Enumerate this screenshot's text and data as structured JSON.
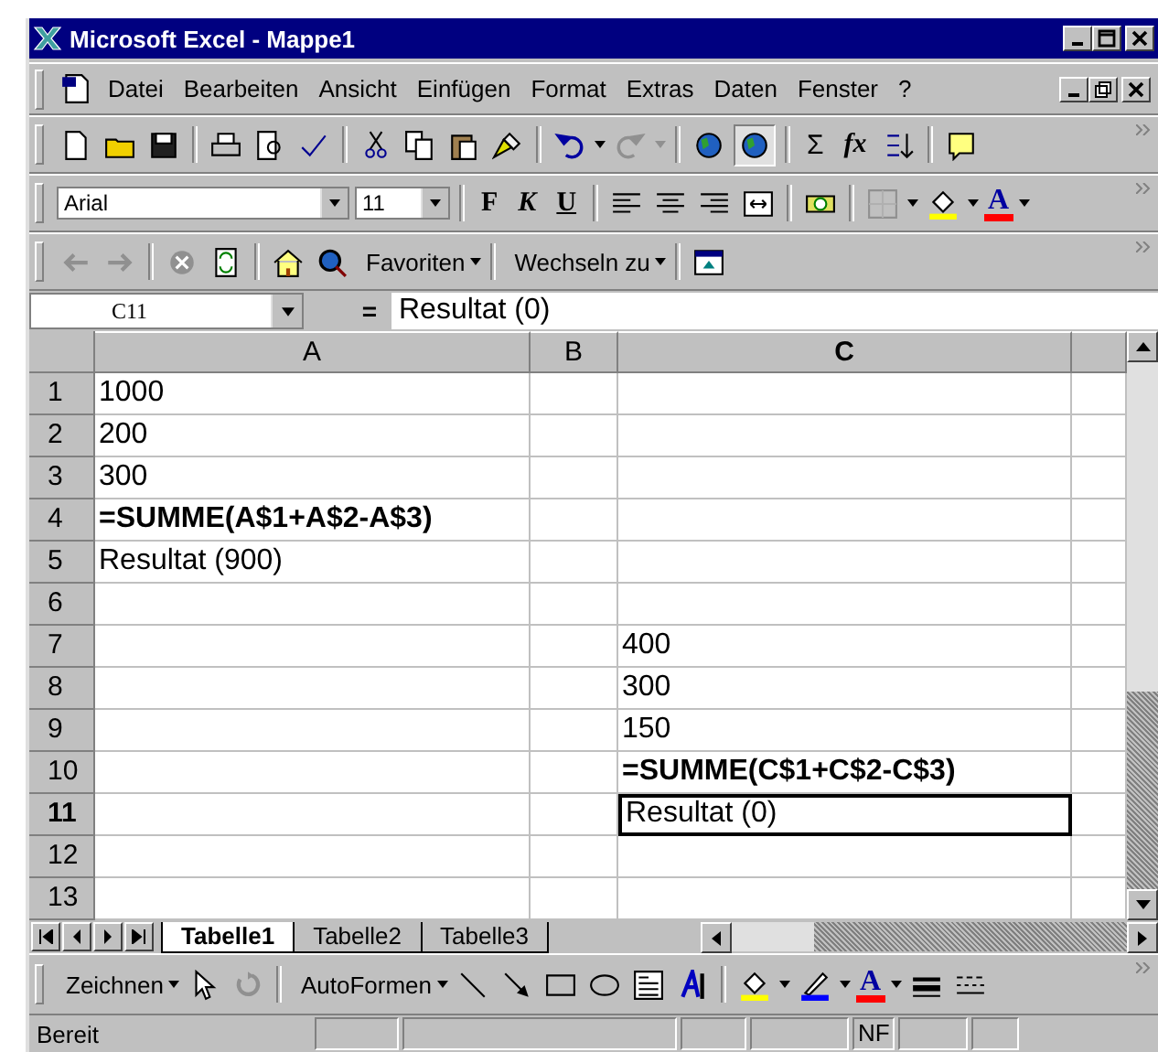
{
  "window": {
    "title": "Microsoft Excel - Mappe1"
  },
  "menu": [
    "Datei",
    "Bearbeiten",
    "Ansicht",
    "Einfügen",
    "Format",
    "Extras",
    "Daten",
    "Fenster",
    "?"
  ],
  "standard_toolbar": {
    "sum": "Σ",
    "function": "fx"
  },
  "format_toolbar": {
    "font": "Arial",
    "size": "11",
    "bold": "F",
    "italic": "K",
    "underline": "U",
    "font_color": "A"
  },
  "web_toolbar": {
    "favorites": "Favoriten",
    "go_to": "Wechseln zu"
  },
  "formula_bar": {
    "name_box": "C11",
    "equals": "=",
    "formula": "Resultat (0)"
  },
  "columns": [
    {
      "label": "A",
      "selected": false
    },
    {
      "label": "B",
      "selected": false
    },
    {
      "label": "C",
      "selected": true
    }
  ],
  "rows": [
    {
      "header": "1",
      "selected": false,
      "cells": [
        {
          "text": "1000",
          "bold": false,
          "selected": false
        },
        {
          "selected": false
        },
        {
          "selected": false
        }
      ]
    },
    {
      "header": "2",
      "selected": false,
      "cells": [
        {
          "text": "200",
          "bold": false,
          "selected": false
        },
        {
          "selected": false
        },
        {
          "selected": false
        }
      ]
    },
    {
      "header": "3",
      "selected": false,
      "cells": [
        {
          "text": "300",
          "bold": false,
          "selected": false
        },
        {
          "selected": false
        },
        {
          "selected": false
        }
      ]
    },
    {
      "header": "4",
      "selected": false,
      "cells": [
        {
          "text": "=SUMME(A$1+A$2-A$3)",
          "bold": true,
          "selected": false
        },
        {
          "selected": false
        },
        {
          "selected": false
        }
      ]
    },
    {
      "header": "5",
      "selected": false,
      "cells": [
        {
          "text": "Resultat (900)",
          "bold": false,
          "selected": false
        },
        {
          "selected": false
        },
        {
          "selected": false
        }
      ]
    },
    {
      "header": "6",
      "selected": false,
      "cells": [
        {
          "selected": false
        },
        {
          "selected": false
        },
        {
          "selected": false
        }
      ]
    },
    {
      "header": "7",
      "selected": false,
      "cells": [
        {
          "selected": false
        },
        {
          "selected": false
        },
        {
          "text": "400",
          "bold": false,
          "selected": false
        }
      ]
    },
    {
      "header": "8",
      "selected": false,
      "cells": [
        {
          "selected": false
        },
        {
          "selected": false
        },
        {
          "text": "300",
          "bold": false,
          "selected": false
        }
      ]
    },
    {
      "header": "9",
      "selected": false,
      "cells": [
        {
          "selected": false
        },
        {
          "selected": false
        },
        {
          "text": "150",
          "bold": false,
          "selected": false
        }
      ]
    },
    {
      "header": "10",
      "selected": false,
      "cells": [
        {
          "selected": false
        },
        {
          "selected": false
        },
        {
          "text": "=SUMME(C$1+C$2-C$3)",
          "bold": true,
          "selected": false
        }
      ]
    },
    {
      "header": "11",
      "selected": true,
      "cells": [
        {
          "selected": false
        },
        {
          "selected": false
        },
        {
          "text": "Resultat (0)",
          "bold": false,
          "selected": true
        }
      ]
    },
    {
      "header": "12",
      "selected": false,
      "cells": [
        {
          "selected": false
        },
        {
          "selected": false
        },
        {
          "selected": false
        }
      ]
    },
    {
      "header": "13",
      "selected": false,
      "cells": [
        {
          "selected": false
        },
        {
          "selected": false
        },
        {
          "selected": false
        }
      ]
    }
  ],
  "sheet_tabs": [
    {
      "label": "Tabelle1",
      "selected": true
    },
    {
      "label": "Tabelle2",
      "selected": false
    },
    {
      "label": "Tabelle3",
      "selected": false
    }
  ],
  "drawing_toolbar": {
    "draw": "Zeichnen",
    "autoshapes": "AutoFormen",
    "font_color": "A"
  },
  "status_bar": {
    "text": "Bereit",
    "indicator": "NF"
  }
}
